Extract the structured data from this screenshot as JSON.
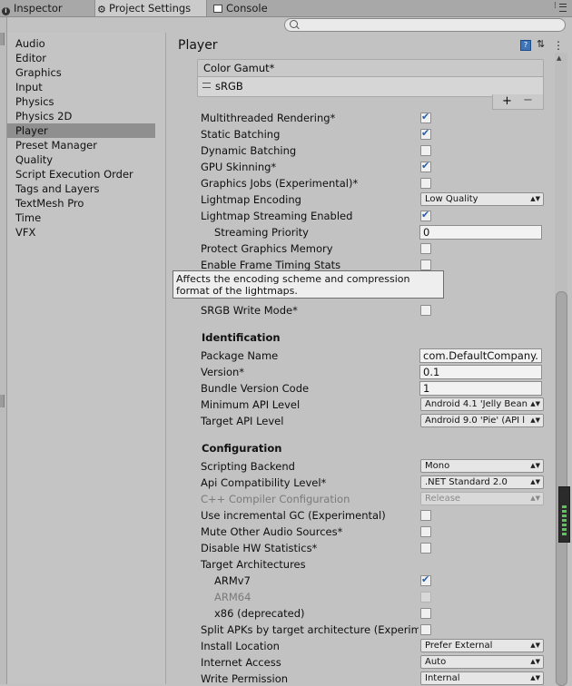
{
  "tabs": [
    {
      "label": "Inspector",
      "icon": "info-icon",
      "active": false
    },
    {
      "label": "Project Settings",
      "icon": "gear-icon",
      "active": true
    },
    {
      "label": "Console",
      "icon": "console-icon",
      "active": false
    }
  ],
  "sidebar": {
    "items": [
      "Audio",
      "Editor",
      "Graphics",
      "Input",
      "Physics",
      "Physics 2D",
      "Player",
      "Preset Manager",
      "Quality",
      "Script Execution Order",
      "Tags and Layers",
      "TextMesh Pro",
      "Time",
      "VFX"
    ],
    "selected": "Player"
  },
  "page_title": "Player",
  "color_gamut": {
    "label": "Color Gamut*",
    "items": [
      "sRGB"
    ],
    "add": "+",
    "remove": "−"
  },
  "rows": {
    "multithreaded": {
      "label": "Multithreaded Rendering*",
      "checked": true
    },
    "static_batching": {
      "label": "Static Batching",
      "checked": true
    },
    "dynamic_batching": {
      "label": "Dynamic Batching",
      "checked": false
    },
    "gpu_skinning": {
      "label": "GPU Skinning*",
      "checked": true
    },
    "graphics_jobs": {
      "label": "Graphics Jobs (Experimental)*",
      "checked": false
    },
    "lightmap_encoding": {
      "label": "Lightmap Encoding",
      "value": "Low Quality"
    },
    "lightmap_streaming": {
      "label": "Lightmap Streaming Enabled",
      "checked": true
    },
    "streaming_priority": {
      "label": "Streaming Priority",
      "value": "0"
    },
    "protect_memory": {
      "label": "Protect Graphics Memory",
      "checked": false
    },
    "frame_timing": {
      "label": "Enable Frame Timing Stats",
      "checked": false
    },
    "srgb_write": {
      "label": "SRGB Write Mode*",
      "checked": false
    }
  },
  "tooltip": {
    "line1": "Affects the encoding scheme and compression",
    "line2": "format of the lightmaps."
  },
  "identification": {
    "header": "Identification",
    "package_name": {
      "label": "Package Name",
      "value": "com.DefaultCompany."
    },
    "version": {
      "label": "Version*",
      "value": "0.1"
    },
    "bundle_code": {
      "label": "Bundle Version Code",
      "value": "1"
    },
    "min_api": {
      "label": "Minimum API Level",
      "value": "Android 4.1 'Jelly Bean"
    },
    "target_api": {
      "label": "Target API Level",
      "value": "Android 9.0 'Pie' (API l"
    }
  },
  "configuration": {
    "header": "Configuration",
    "scripting_backend": {
      "label": "Scripting Backend",
      "value": "Mono"
    },
    "api_compat": {
      "label": "Api Compatibility Level*",
      "value": ".NET Standard 2.0"
    },
    "cpp_config": {
      "label": "C++ Compiler Configuration",
      "value": "Release"
    },
    "incremental_gc": {
      "label": "Use incremental GC (Experimental)",
      "checked": false
    },
    "mute_audio": {
      "label": "Mute Other Audio Sources*",
      "checked": false
    },
    "disable_hw_stats": {
      "label": "Disable HW Statistics*",
      "checked": false
    },
    "target_arch": {
      "label": "Target Architectures"
    },
    "armv7": {
      "label": "ARMv7",
      "checked": true
    },
    "arm64": {
      "label": "ARM64",
      "checked": false
    },
    "x86": {
      "label": "x86 (deprecated)",
      "checked": false
    },
    "split_apks": {
      "label": "Split APKs by target architecture (Experim",
      "checked": false
    },
    "install_location": {
      "label": "Install Location",
      "value": "Prefer External"
    },
    "internet_access": {
      "label": "Internet Access",
      "value": "Auto"
    },
    "write_permission": {
      "label": "Write Permission",
      "value": "Internal"
    }
  },
  "icons": {
    "dropdown_arrow": "▲▼",
    "scroll_up": "▲"
  },
  "colors": {
    "selection": "#8f8f8f",
    "checkbox_check": "#2d5ea0",
    "help_blue": "#3e74b8",
    "meter_green": "#5fc25b"
  }
}
